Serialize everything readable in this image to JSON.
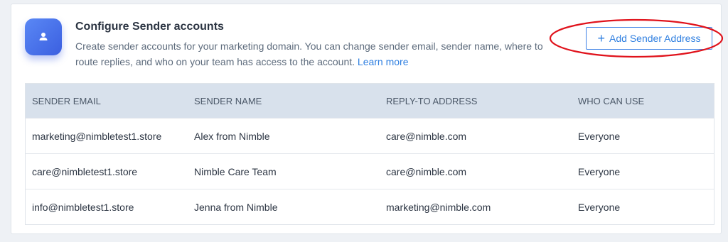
{
  "header": {
    "title": "Configure Sender accounts",
    "description": "Create sender accounts for your marketing domain. You can change sender email, sender name, where to route replies, and who on your team has access to the account.",
    "learn_more": "Learn more",
    "avatar_icon": "user-icon"
  },
  "toolbar": {
    "add_label": "Add Sender Address",
    "add_icon": "plus-icon"
  },
  "table": {
    "columns": [
      "SENDER EMAIL",
      "SENDER NAME",
      "REPLY-TO ADDRESS",
      "WHO CAN USE"
    ],
    "rows": [
      [
        "marketing@nimbletest1.store",
        "Alex from Nimble",
        "care@nimble.com",
        "Everyone"
      ],
      [
        "care@nimbletest1.store",
        "Nimble Care Team",
        "care@nimble.com",
        "Everyone"
      ],
      [
        "info@nimbletest1.store",
        "Jenna from Nimble",
        "marketing@nimble.com",
        "Everyone"
      ]
    ]
  },
  "colors": {
    "accent": "#2f7fe0",
    "annotation": "#e0121b",
    "header_bg": "#d8e1ec"
  }
}
